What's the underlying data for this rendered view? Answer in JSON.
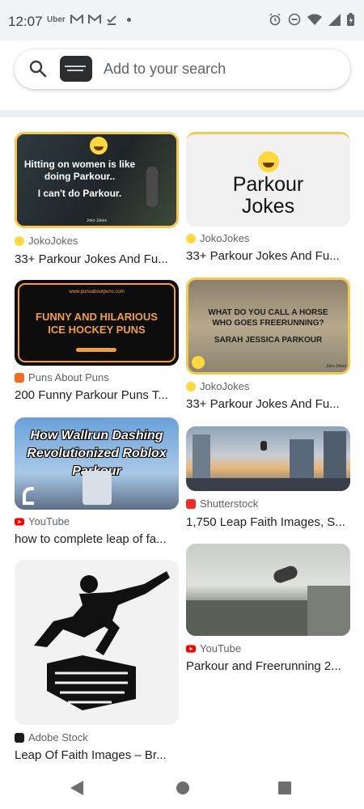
{
  "status_bar": {
    "time": "12:07",
    "notification_icons": [
      "uber-icon",
      "gmail-icon",
      "gmail-icon",
      "task-icon",
      "dot-icon"
    ],
    "uber_label": "Uber",
    "right_icons": [
      "alarm-icon",
      "dnd-icon",
      "wifi-icon",
      "signal-icon",
      "battery-icon"
    ]
  },
  "search": {
    "placeholder": "Add to your search"
  },
  "results": [
    {
      "source": "JokoJokes",
      "title": "33+ Parkour Jokes And Fu...",
      "image_caption": "Hitting on women is like doing Parkour.. I can't do Parkour."
    },
    {
      "source": "JokoJokes",
      "title": "33+ Parkour Jokes And Fu...",
      "image_caption": "Parkour Jokes"
    },
    {
      "source": "Puns About Puns",
      "title": "200 Funny Parkour Puns T...",
      "image_caption": "FUNNY AND HILARIOUS ICE HOCKEY PUNS"
    },
    {
      "source": "JokoJokes",
      "title": "33+ Parkour Jokes And Fu...",
      "image_caption": "WHAT DO YOU CALL A HORSE WHO GOES FREERUNNING? SARAH JESSICA PARKOUR"
    },
    {
      "source": "YouTube",
      "title": "how to complete leap of fa...",
      "image_caption": "How Wallrun Dashing Revolutionized Roblox Parkour"
    },
    {
      "source": "Shutterstock",
      "title": "1,750 Leap Faith Images, S...",
      "image_caption": ""
    },
    {
      "source": "Adobe Stock",
      "title": "Leap Of Faith Images – Br...",
      "image_caption": ""
    },
    {
      "source": "YouTube",
      "title": "Parkour and Freerunning 2...",
      "image_caption": ""
    }
  ],
  "image_texts": {
    "joko_line1": "Hitting on women is like",
    "joko_line2": "doing Parkour..",
    "joko_line3": "I can't do Parkour.",
    "joko_brand": "Joko Jokes",
    "parkour_jokes_l1": "Parkour",
    "parkour_jokes_l2": "Jokes",
    "puns_url": "www.punsaboutpuns.com",
    "puns_l1": "FUNNY AND HILARIOUS",
    "puns_l2": "ICE HOCKEY PUNS",
    "horse_l1": "WHAT DO YOU CALL A HORSE",
    "horse_l2": "WHO GOES FREERUNNING?",
    "horse_l3": "SARAH JESSICA PARKOUR",
    "horse_brand": "Joko Jokes",
    "yt_l1": "How Wallrun Dashing",
    "yt_l2": "Revolutionized Roblox Parkour"
  },
  "nav": {
    "icons": [
      "back-icon",
      "home-icon",
      "recents-icon"
    ]
  },
  "colors": {
    "accent_yellow": "#f2c94c",
    "youtube_red": "#ff0000",
    "shutterstock_red": "#ee2b24",
    "puns_orange": "#f36c21",
    "adobe_dark": "#1a1a1a"
  }
}
